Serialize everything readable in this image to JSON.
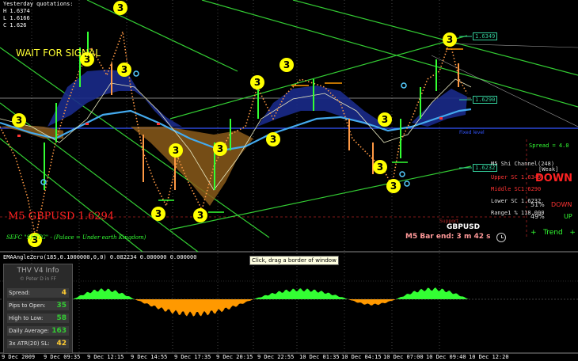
{
  "quotes": {
    "title": "Yesterday quotations:",
    "high": "H 1.6374",
    "low": "L 1.6166",
    "close": "C 1.626"
  },
  "banner": "WAIT FOR SIGNAL",
  "symbol_large": "M5 GBPUSD 1.6294",
  "signature": "SEFC \"Sf-TTG\" - (Palace = Under earth Kingdom)",
  "price_labels": [
    "1.6349",
    "1.6290",
    "1.6232"
  ],
  "trend_panel": {
    "spread": "Spread =   4.0",
    "channel": "M5 Shi Channel(248)",
    "weak": "[Weak]",
    "upper": "Upper SC 1.6349",
    "middle": "Middle SC1.6290",
    "lower": "Lower SC 1.6232",
    "range": "Range1 % 118.000",
    "direction": "DOWN",
    "down_pct": "51%",
    "down_label": "DOWN",
    "up_pct": "49%",
    "up_label": "UP",
    "trend": "+   Trend   +",
    "support": "Support"
  },
  "bar_info": {
    "symbol": "GBPUSD",
    "bar_end": "M5 Bar end: 3 m 42 s",
    "clock_icon": "clock-icon"
  },
  "fixed_level_label": "Fixed level",
  "indicator": {
    "title": "EMAAngleZero(185,0.1000000,0,0) 0.082234 0.000000 0.000000",
    "tooltip": "Click, drag a border of window"
  },
  "thv_panel": {
    "title": "THV V4 Info",
    "author": "© Peter D in FF",
    "rows": [
      {
        "label": "Spread:",
        "value": "4",
        "color": "#ffcc33"
      },
      {
        "label": "Pips to Open:",
        "value": "35",
        "color": "#33cc33"
      },
      {
        "label": "High to Low:",
        "value": "58",
        "color": "#33cc33"
      },
      {
        "label": "Daily Average:",
        "value": "163",
        "color": "#33cc33"
      },
      {
        "label": "3x ATR(20) SL:",
        "value": "42",
        "color": "#ffcc33"
      }
    ]
  },
  "time_axis": [
    "9 Dec 2009",
    "9 Dec 09:35",
    "9 Dec 12:15",
    "9 Dec 14:55",
    "9 Dec 17:35",
    "9 Dec 20:15",
    "9 Dec 22:55",
    "10 Dec 01:35",
    "10 Dec 04:15",
    "10 Dec 07:00",
    "10 Dec 09:40",
    "10 Dec 12:20"
  ],
  "signal_marker": "3",
  "colors": {
    "background": "#000000",
    "channel_line": "#33cc33",
    "cloud_blue": "#1a2a8a",
    "cloud_brown": "#8a5a1a",
    "histogram_up": "#33ff33",
    "histogram_down": "#ff9900",
    "marker_yellow": "#ffff00"
  }
}
